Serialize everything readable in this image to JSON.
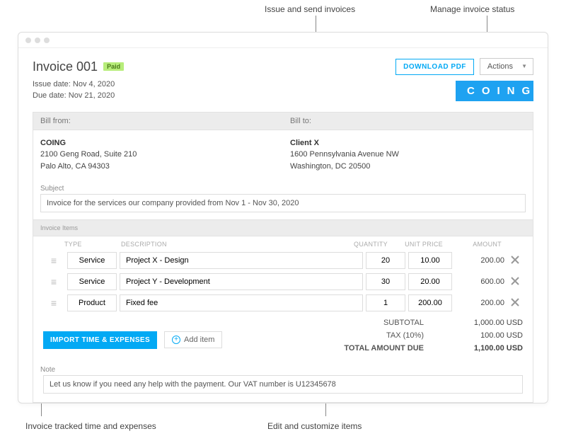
{
  "annotations": {
    "issue_send": "Issue and send invoices",
    "manage_status": "Manage invoice status",
    "invoice_tracked": "Invoice tracked time and expenses",
    "edit_items": "Edit and customize items"
  },
  "header": {
    "title": "Invoice 001",
    "status_badge": "Paid",
    "download_label": "DOWNLOAD PDF",
    "actions_label": "Actions",
    "issue_date_label": "Issue date:",
    "issue_date": "Nov 4, 2020",
    "due_date_label": "Due date:",
    "due_date": "Nov 21, 2020",
    "brand": "COING"
  },
  "billing": {
    "from_label": "Bill from:",
    "to_label": "Bill to:",
    "from": {
      "name": "COING",
      "line1": "2100 Geng Road, Suite 210",
      "line2": "Palo Alto, CA 94303"
    },
    "to": {
      "name": "Client X",
      "line1": "1600 Pennsylvania Avenue NW",
      "line2": "Washington, DC 20500"
    }
  },
  "subject": {
    "label": "Subject",
    "value": "Invoice for the services our company provided from Nov 1 - Nov 30, 2020"
  },
  "items": {
    "section_label": "Invoice Items",
    "columns": {
      "type": "TYPE",
      "description": "DESCRIPTION",
      "quantity": "QUANTITY",
      "unit_price": "UNIT PRICE",
      "amount": "AMOUNT"
    },
    "rows": [
      {
        "type": "Service",
        "description": "Project X - Design",
        "quantity": "20",
        "unit_price": "10.00",
        "amount": "200.00"
      },
      {
        "type": "Service",
        "description": "Project Y - Development",
        "quantity": "30",
        "unit_price": "20.00",
        "amount": "600.00"
      },
      {
        "type": "Product",
        "description": "Fixed fee",
        "quantity": "1",
        "unit_price": "200.00",
        "amount": "200.00"
      }
    ],
    "import_label": "IMPORT TIME & EXPENSES",
    "add_label": "Add item"
  },
  "totals": {
    "subtotal_label": "SUBTOTAL",
    "subtotal": "1,000.00 USD",
    "tax_label": "TAX  (10%)",
    "tax": "100.00 USD",
    "total_label": "TOTAL AMOUNT DUE",
    "total": "1,100.00 USD"
  },
  "note": {
    "label": "Note",
    "value": "Let us know if you need any help with the payment. Our VAT number is U12345678"
  }
}
